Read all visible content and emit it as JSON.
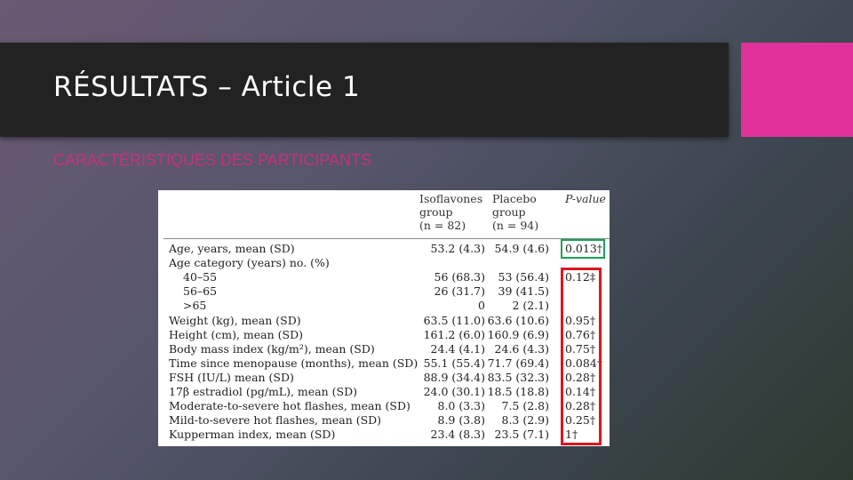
{
  "slide": {
    "title": "RÉSULTATS – Article 1",
    "subtitle": "CARACTÉRISTIQUES DES PARTICIPANTS"
  },
  "table": {
    "headers": {
      "iso_line1": "Isoflavones",
      "iso_line2": "group",
      "iso_line3": "(n = 82)",
      "pla_line1": "Placebo",
      "pla_line2": "group",
      "pla_line3": "(n = 94)",
      "pvalue": "P-value"
    },
    "rows": [
      {
        "label": "Age, years, mean (SD)",
        "iso": "53.2 (4.3)",
        "pla": "54.9 (4.6)",
        "p": "0.013†"
      },
      {
        "label": "Age category (years) no. (%)",
        "iso": "",
        "pla": "",
        "p": ""
      },
      {
        "label": "40–55",
        "iso": "56 (68.3)",
        "pla": "53 (56.4)",
        "p": "0.12‡"
      },
      {
        "label": "56–65",
        "iso": "26 (31.7)",
        "pla": "39 (41.5)",
        "p": ""
      },
      {
        "label": ">65",
        "iso": "0",
        "pla": "2 (2.1)",
        "p": ""
      },
      {
        "label": "Weight (kg), mean (SD)",
        "iso": "63.5 (11.0)",
        "pla": "63.6 (10.6)",
        "p": "0.95†"
      },
      {
        "label": "Height (cm), mean (SD)",
        "iso": "161.2 (6.0)",
        "pla": "160.9 (6.9)",
        "p": "0.76†"
      },
      {
        "label": "Body mass index (kg/m²), mean (SD)",
        "iso": "24.4 (4.1)",
        "pla": "24.6 (4.3)",
        "p": "0.75†"
      },
      {
        "label": "Time since menopause (months), mean (SD)",
        "iso": "55.1 (55.4)",
        "pla": "71.7 (69.4)",
        "p": "0.084†"
      },
      {
        "label": "FSH (IU/L) mean (SD)",
        "iso": "88.9 (34.4)",
        "pla": "83.5 (32.3)",
        "p": "0.28†"
      },
      {
        "label": "17β estradiol (pg/mL), mean (SD)",
        "iso": "24.0 (30.1)",
        "pla": "18.5 (18.8)",
        "p": "0.14†"
      },
      {
        "label": "Moderate-to-severe hot flashes, mean (SD)",
        "iso": "8.0 (3.3)",
        "pla": "7.5 (2.8)",
        "p": "0.28†"
      },
      {
        "label": "Mild-to-severe hot flashes, mean (SD)",
        "iso": "8.9 (3.8)",
        "pla": "8.3 (2.9)",
        "p": "0.25†"
      },
      {
        "label": "Kupperman index, mean (SD)",
        "iso": "23.4 (8.3)",
        "pla": "23.5 (7.1)",
        "p": "1†"
      }
    ]
  },
  "highlight_colors": {
    "green_box": "#1ca05a",
    "red_box": "#e0141e",
    "accent": "#e0329a"
  }
}
